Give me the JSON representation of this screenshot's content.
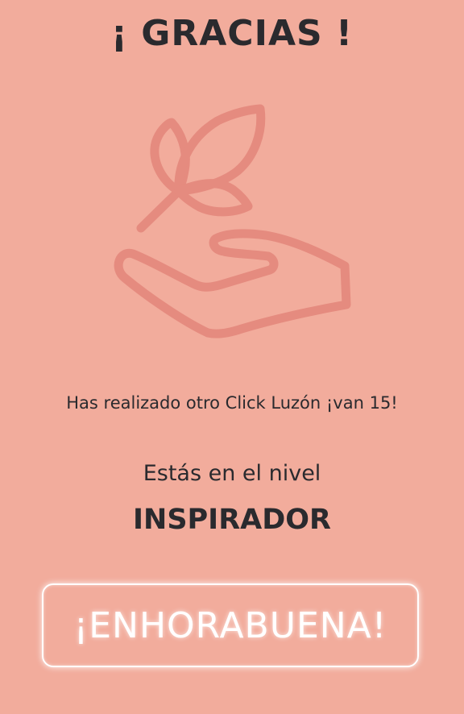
{
  "header": {
    "title": "¡ GRACIAS !"
  },
  "illustration": {
    "icon": "hand-holding-plant-icon",
    "color": "#e58b7f"
  },
  "content": {
    "message": "Has realizado otro Click Luzón ¡van 15!",
    "level_label": "Estás en el nivel",
    "level_name": "INSPIRADOR"
  },
  "action": {
    "button_label": "¡ENHORABUENA!"
  },
  "colors": {
    "background": "#f2ac9c",
    "text": "#2a2a2e",
    "button_border": "#ffffff"
  }
}
